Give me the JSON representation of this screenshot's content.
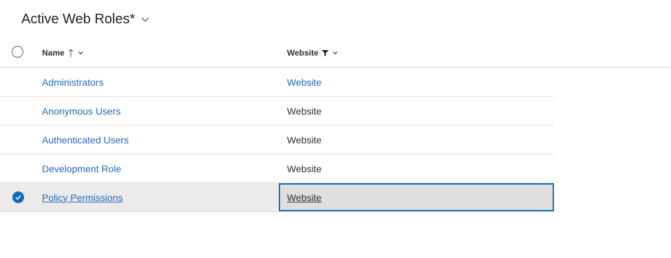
{
  "view": {
    "title": "Active Web Roles*"
  },
  "columns": {
    "name": {
      "label": "Name",
      "sort": "ascending"
    },
    "website": {
      "label": "Website",
      "filtered": true
    }
  },
  "rows": [
    {
      "name": "Administrators",
      "website": "Website",
      "website_is_link": true,
      "selected": false
    },
    {
      "name": "Anonymous Users",
      "website": "Website",
      "website_is_link": false,
      "selected": false
    },
    {
      "name": "Authenticated Users",
      "website": "Website",
      "website_is_link": false,
      "selected": false
    },
    {
      "name": "Development Role",
      "website": "Website",
      "website_is_link": false,
      "selected": false
    },
    {
      "name": "Policy Permissions",
      "website": "Website",
      "website_is_link": true,
      "selected": true
    }
  ],
  "colors": {
    "link": "#1f6bbf",
    "accent": "#0f6cbd",
    "selected_row": "#edebe9"
  }
}
